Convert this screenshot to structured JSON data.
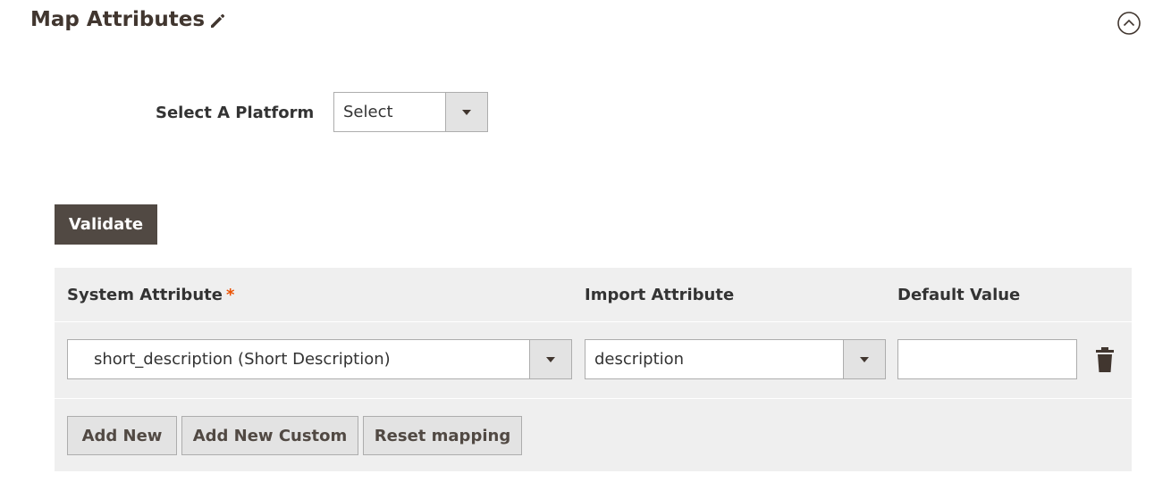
{
  "section": {
    "title": "Map Attributes"
  },
  "platform": {
    "label": "Select A Platform",
    "selected": "Select"
  },
  "actions": {
    "validate_label": "Validate"
  },
  "table": {
    "headers": {
      "system_attribute": "System Attribute",
      "required_marker": "*",
      "import_attribute": "Import Attribute",
      "default_value": "Default Value"
    },
    "rows": [
      {
        "system_attribute": "short_description (Short Description)",
        "import_attribute": "description",
        "default_value": ""
      }
    ],
    "buttons": {
      "add_new": "Add New",
      "add_new_custom": "Add New Custom",
      "reset_mapping": "Reset mapping"
    }
  },
  "icons": {
    "edit": "pencil-icon",
    "collapse": "chevron-up-circle-icon",
    "delete": "trash-icon",
    "dropdown": "caret-down-icon"
  },
  "colors": {
    "primary_button": "#514943",
    "required": "#eb5202",
    "table_bg": "#efefef",
    "secondary_button": "#e3e3e3"
  }
}
